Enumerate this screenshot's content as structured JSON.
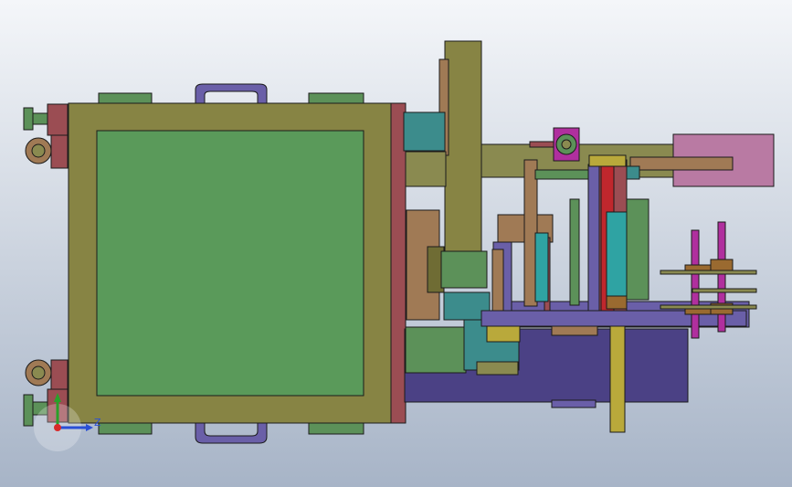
{
  "viewport": {
    "background_top": "#f4f6f9",
    "background_bottom": "#a7b4c7",
    "outline_color": "#1b1b1b"
  },
  "palette": {
    "olive": "#878444",
    "olive_dark": "#6f6c34",
    "green_panel": "#5a9a5a",
    "green_part": "#5c9159",
    "teal": "#3c8c8c",
    "maroon": "#9b4d53",
    "purple": "#4b4185",
    "purple_light": "#6a5fa8",
    "pink": "#b97aa3",
    "khaki": "#8a8a50",
    "tan": "#a07a55",
    "red": "#c0272d",
    "cyan": "#2fa3a3",
    "magenta": "#b02f9e",
    "brown": "#9a6a30",
    "yellow": "#b9a93b"
  },
  "triad": {
    "z_label": "Z",
    "z_color": "#2a4fd6",
    "y_color": "#2aa02a",
    "origin_color": "#d82a2a"
  }
}
